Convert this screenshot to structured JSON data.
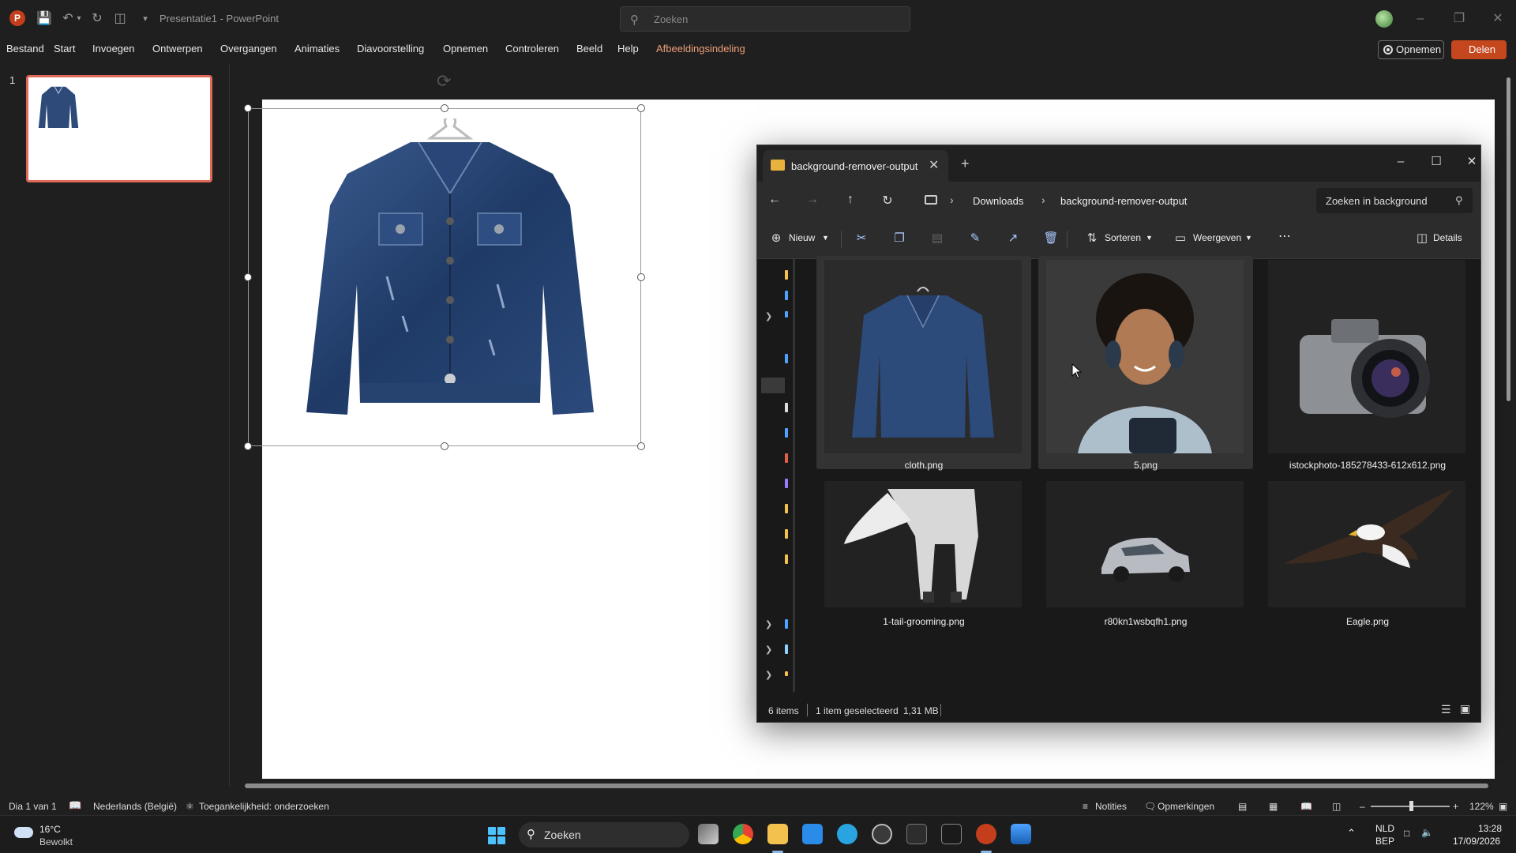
{
  "app": {
    "logo": "P",
    "title": "Presentatie1 - PowerPoint",
    "search_placeholder": "Zoeken"
  },
  "menu": {
    "items": [
      "Bestand",
      "Start",
      "Invoegen",
      "Ontwerpen",
      "Overgangen",
      "Animaties",
      "Diavoorstelling",
      "Opnemen",
      "Controleren",
      "Beeld",
      "Help"
    ],
    "contextual": "Afbeeldingsindeling",
    "record_label": "Opnemen",
    "share_label": "Delen"
  },
  "thumbnails": {
    "slide_number": "1"
  },
  "explorer": {
    "tab_title": "background-remover-output",
    "breadcrumb": [
      "Downloads",
      "background-remover-output"
    ],
    "search_placeholder": "Zoeken in background",
    "commands": {
      "new": "Nieuw",
      "sort": "Sorteren",
      "view": "Weergeven",
      "details": "Details"
    },
    "files": [
      {
        "name": "cloth.png",
        "selected": true
      },
      {
        "name": "5.png",
        "selected": true
      },
      {
        "name": "istockphoto-185278433-612x612.png",
        "selected": false
      },
      {
        "name": "1-tail-grooming.png",
        "selected": false
      },
      {
        "name": "r80kn1wsbqfh1.png",
        "selected": false
      },
      {
        "name": "Eagle.png",
        "selected": false
      }
    ],
    "status": {
      "count": "6 items",
      "selection": "1 item geselecteerd",
      "size": "1,31 MB"
    }
  },
  "statusbar": {
    "slide": "Dia 1 van 1",
    "language": "Nederlands (België)",
    "accessibility": "Toegankelijkheid: onderzoeken",
    "notes": "Notities",
    "comments": "Opmerkingen",
    "zoom": "122%"
  },
  "taskbar": {
    "temp": "16°C",
    "weather": "Bewolkt",
    "search_placeholder": "Zoeken",
    "lang1": "NLD",
    "lang2": "BEP",
    "time": "13:28",
    "date": "17/09/2026"
  },
  "colors": {
    "accent": "#c43e1c",
    "contextual_tab": "#f0a07a",
    "selection": "#e06a5a"
  }
}
